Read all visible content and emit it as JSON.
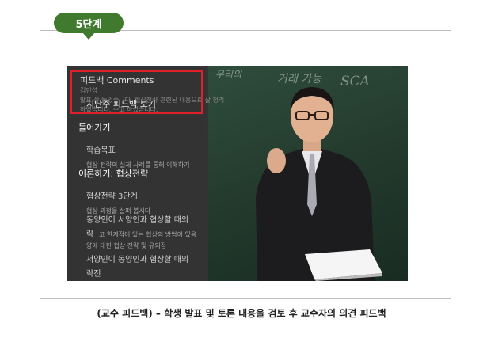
{
  "step": {
    "label": "5단계"
  },
  "panel": {
    "header": "피드백 Comments",
    "author": "김민섭",
    "preview_line_1": "발표 잘 들었습니다. 협상전략 관련된 내용으로 잘 정리",
    "preview_line_2": "하였습니다. 수고 하셨습니다.",
    "past_feedback_link": "지난주 피드백 보기",
    "enter_section": "들어가기",
    "learning_goal": "학습목표",
    "learning_goal_detail": "협상 전략의 실제 사례를 통해 이해하기",
    "theory_section": "이론하기: 협상전략",
    "strategy_step": "협상전략 3단계",
    "strategy_detail": "협상 과정을 살펴 봅시다",
    "topic_east_west": "동양인이 서양인과 협상할 때의",
    "topic_east_west_suffix": "략",
    "topic_detail": "고 한계점이 있는 협상의 방법이 있음",
    "topic_detail_2": "양에 대한 협상 전략 및 유의점",
    "topic_west_east": "서양인이 동양인과 협상할 때의",
    "topic_west_east_suffix": "략전"
  },
  "board_writing": [
    "우리의",
    "거래 가능",
    "SCA"
  ],
  "caption": "(교수 피드백) – 학생 발표 및 토론 내용을 검토 후 교수자의 의견 피드백",
  "colors": {
    "badge": "#3f7a2e",
    "highlight": "#e0202a",
    "board": "#2f4d3c",
    "panel": "#343434"
  }
}
